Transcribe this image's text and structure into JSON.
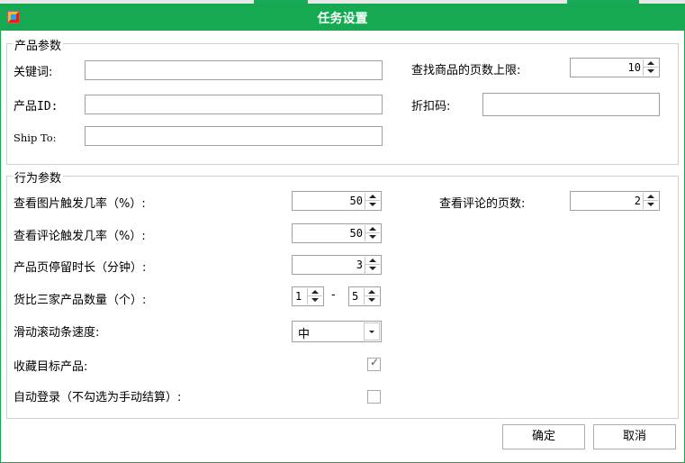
{
  "window": {
    "title": "任务设置",
    "accent_color": "#16a951",
    "icon": "app-icon"
  },
  "product_params": {
    "legend": "产品参数",
    "keyword_label": "关键词:",
    "keyword_value": "",
    "product_id_label": "产品ID:",
    "product_id_value": "",
    "ship_to_label": "Ship To:",
    "ship_to_value": "",
    "page_limit_label": "查找商品的页数上限:",
    "page_limit_value": "10",
    "discount_label": "折扣码:",
    "discount_value": ""
  },
  "behavior_params": {
    "legend": "行为参数",
    "image_rate_label": "查看图片触发几率（%）:",
    "image_rate_value": "50",
    "review_rate_label": "查看评论触发几率（%）:",
    "review_rate_value": "50",
    "stay_time_label": "产品页停留时长（分钟）:",
    "stay_time_value": "3",
    "compare_label": "货比三家产品数量（个）:",
    "compare_min": "1",
    "compare_sep": "-",
    "compare_max": "5",
    "scroll_speed_label": "滑动滚动条速度:",
    "scroll_speed_value": "中",
    "favorite_label": "收藏目标产品:",
    "favorite_checked_mark": "✓",
    "auto_login_label": "自动登录（不勾选为手动结算）:",
    "review_pages_label": "查看评论的页数:",
    "review_pages_value": "2"
  },
  "buttons": {
    "ok": "确定",
    "cancel": "取消"
  }
}
